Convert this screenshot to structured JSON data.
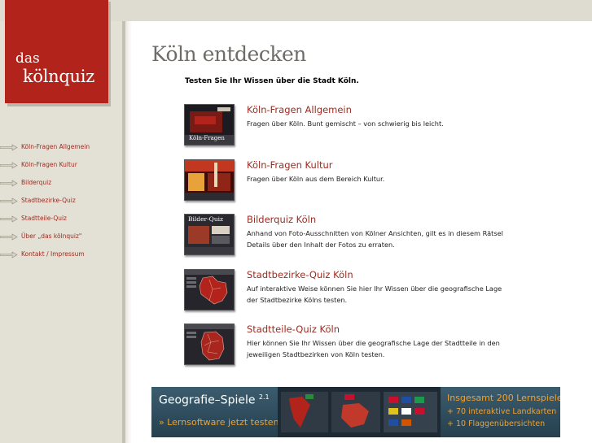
{
  "logo": {
    "line1": "das",
    "line2": "kölnquiz"
  },
  "nav": {
    "items": [
      {
        "label": "Köln-Fragen Allgemein"
      },
      {
        "label": "Köln-Fragen Kultur"
      },
      {
        "label": "Bilderquiz"
      },
      {
        "label": "Stadtbezirke-Quiz"
      },
      {
        "label": "Stadtteile-Quiz"
      },
      {
        "label": "Über „das kölnquiz\""
      },
      {
        "label": "Kontakt / Impressum"
      }
    ]
  },
  "main": {
    "title": "Köln entdecken",
    "intro": "Testen Sie Ihr Wissen über die Stadt Köln.",
    "quizzes": [
      {
        "title": "Köln-Fragen Allgemein",
        "desc": "Fragen über Köln. Bunt gemischt – von schwierig bis leicht.",
        "thumb_label": "Köln-Fragen"
      },
      {
        "title": "Köln-Fragen Kultur",
        "desc": "Fragen über Köln aus dem Bereich Kultur.",
        "thumb_label": ""
      },
      {
        "title": "Bilderquiz Köln",
        "desc": "Anhand von Foto-Ausschnitten von Kölner Ansichten, gilt es in diesem Rätsel Details über den Inhalt der Fotos zu erraten.",
        "thumb_label": "Bilder-Quiz"
      },
      {
        "title": "Stadtbezirke-Quiz Köln",
        "desc": "Auf interaktive Weise können Sie hier Ihr Wissen über die geografische Lage der Stadtbezirke Kölns testen.",
        "thumb_label": ""
      },
      {
        "title": "Stadtteile-Quiz Köln",
        "desc": "Hier können Sie Ihr Wissen über die geografische Lage der Stadtteile in den jeweiligen Stadtbezirken von Köln testen.",
        "thumb_label": ""
      }
    ]
  },
  "banner": {
    "title": "Geografie–Spiele",
    "version": "2.1",
    "subtitle": "» Lernsoftware jetzt testen",
    "right_line1": "Insgesamt 200 Lernspiele",
    "right_line2": "+ 70 interaktive Landkarten",
    "right_line3": "+ 10 Flaggenübersichten"
  },
  "colors": {
    "brand_red": "#b2241b",
    "link_red": "#9c2b20",
    "banner_orange": "#f0a030"
  }
}
